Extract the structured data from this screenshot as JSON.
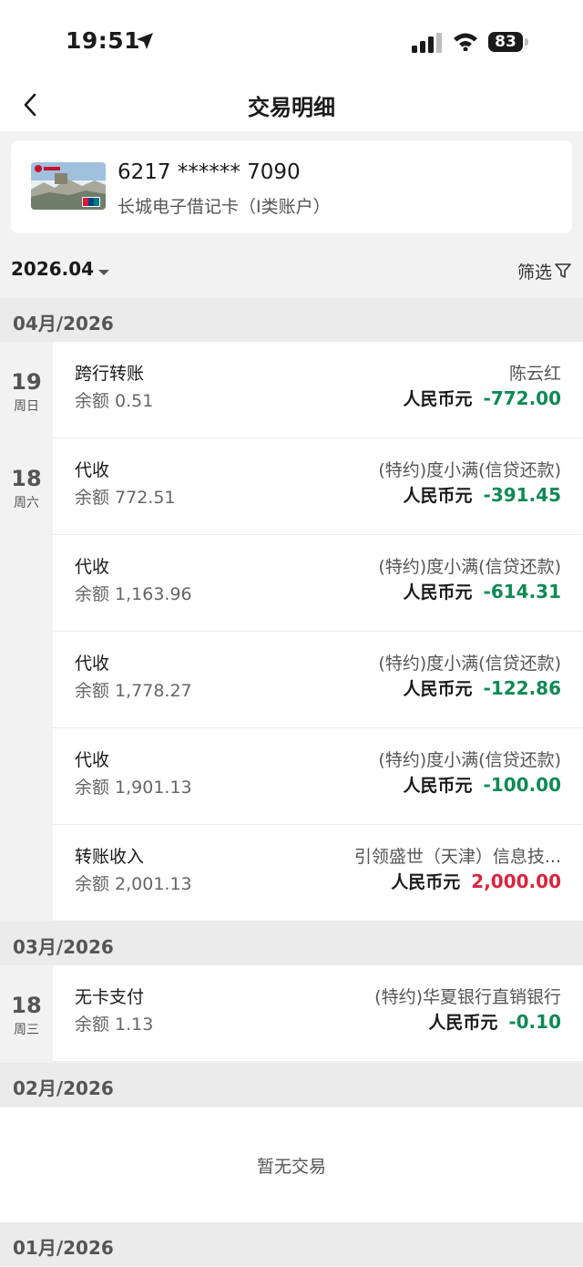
{
  "status": {
    "time": "19:51",
    "battery": "83"
  },
  "nav": {
    "title": "交易明细"
  },
  "card": {
    "number": "6217 ****** 7090",
    "name": "长城电子借记卡（I类账户）"
  },
  "filter": {
    "month": "2026.04",
    "filter_label": "筛选"
  },
  "months": [
    {
      "label": "04月/2026"
    },
    {
      "label": "03月/2026"
    },
    {
      "label": "02月/2026"
    },
    {
      "label": "01月/2026"
    }
  ],
  "days": [
    {
      "num": "19",
      "week": "周日"
    },
    {
      "num": "18",
      "week": "周六"
    },
    {
      "num": "18",
      "week": "周三"
    }
  ],
  "transactions": [
    {
      "type": "跨行转账",
      "balance": "余额 0.51",
      "counterparty": "陈云红",
      "currency": "人民币元",
      "amount": "-772.00",
      "direction": "out"
    },
    {
      "type": "代收",
      "balance": "余额 772.51",
      "counterparty": "(特约)度小满(信贷还款)",
      "currency": "人民币元",
      "amount": "-391.45",
      "direction": "out"
    },
    {
      "type": "代收",
      "balance": "余额 1,163.96",
      "counterparty": "(特约)度小满(信贷还款)",
      "currency": "人民币元",
      "amount": "-614.31",
      "direction": "out"
    },
    {
      "type": "代收",
      "balance": "余额 1,778.27",
      "counterparty": "(特约)度小满(信贷还款)",
      "currency": "人民币元",
      "amount": "-122.86",
      "direction": "out"
    },
    {
      "type": "代收",
      "balance": "余额 1,901.13",
      "counterparty": "(特约)度小满(信贷还款)",
      "currency": "人民币元",
      "amount": "-100.00",
      "direction": "out"
    },
    {
      "type": "转账收入",
      "balance": "余额 2,001.13",
      "counterparty": "引领盛世（天津）信息技...",
      "currency": "人民币元",
      "amount": "2,000.00",
      "direction": "in"
    },
    {
      "type": "无卡支付",
      "balance": "余额 1.13",
      "counterparty": "(特约)华夏银行直销银行",
      "currency": "人民币元",
      "amount": "-0.10",
      "direction": "out"
    }
  ],
  "empty": {
    "text": "暂无交易"
  },
  "colors": {
    "outflow": "#0f8a55",
    "inflow": "#d9253f"
  },
  "icons": [
    "location-arrow-icon",
    "signal-icon",
    "wifi-icon",
    "battery-icon",
    "back-arrow-icon",
    "card-image",
    "caret-down-icon",
    "filter-funnel-icon"
  ]
}
